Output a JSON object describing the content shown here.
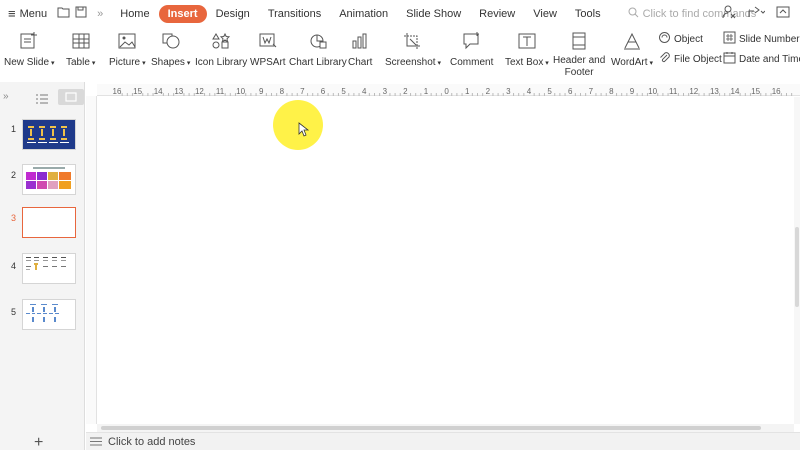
{
  "menubar": {
    "menu_label": "Menu",
    "tabs": [
      "Home",
      "Insert",
      "Design",
      "Transitions",
      "Animation",
      "Slide Show",
      "Review",
      "View",
      "Tools"
    ],
    "active_tab": "Insert",
    "search_placeholder": "Click to find commands"
  },
  "ribbon": {
    "new_slide": "New Slide",
    "table": "Table",
    "picture": "Picture",
    "shapes": "Shapes",
    "icon_library": "Icon Library",
    "wpsart": "WPSArt",
    "chart_library": "Chart Library",
    "chart": "Chart",
    "screenshot": "Screenshot",
    "comment": "Comment",
    "text_box": "Text Box",
    "header_footer_1": "Header and",
    "header_footer_2": "Footer",
    "wordart": "WordArt",
    "object": "Object",
    "file_object": "File Object",
    "slide_number": "Slide Number",
    "date_time": "Date and Time"
  },
  "slides": [
    {
      "num": "1"
    },
    {
      "num": "2"
    },
    {
      "num": "3"
    },
    {
      "num": "4"
    },
    {
      "num": "5"
    }
  ],
  "ruler": {
    "ticks": [
      "16",
      "15",
      "14",
      "13",
      "12",
      "11",
      "10",
      "9",
      "8",
      "7",
      "6",
      "5",
      "4",
      "3",
      "2",
      "1",
      "0",
      "1",
      "2",
      "3",
      "4",
      "5",
      "6",
      "7",
      "8",
      "9",
      "10",
      "11",
      "12",
      "13",
      "14",
      "15",
      "16"
    ]
  },
  "notes": {
    "placeholder": "Click to add notes"
  },
  "colors": {
    "accent": "#e8663d",
    "pointer": "#fff028",
    "thumb1_bg": "#1f3a8a"
  }
}
